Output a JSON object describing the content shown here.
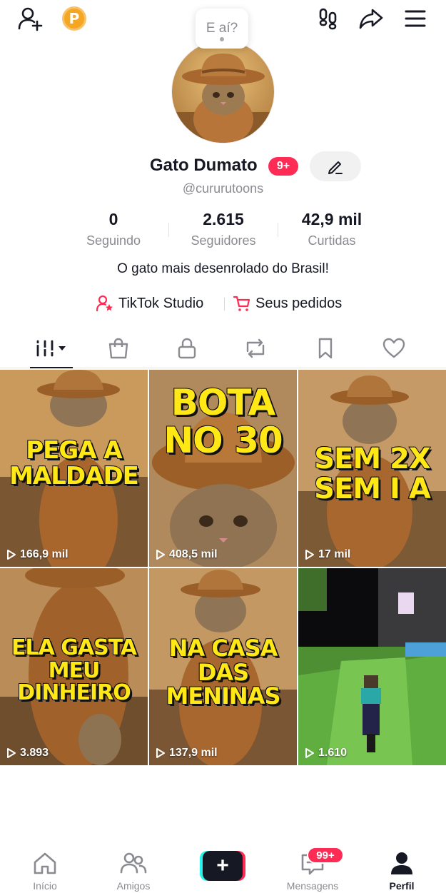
{
  "header": {
    "add_friend_icon": "person-plus-icon",
    "coin_label": "P",
    "footprint_icon": "footprint-icon",
    "share_icon": "share-arrow-icon",
    "menu_icon": "hamburger-icon"
  },
  "tooltip": {
    "text": "E aí?"
  },
  "profile": {
    "name": "Gato Dumato",
    "badge": "9+",
    "handle": "@cururutoons",
    "bio": "O gato mais desenrolado do Brasil!"
  },
  "stats": [
    {
      "value": "0",
      "label": "Seguindo"
    },
    {
      "value": "2.615",
      "label": "Seguidores"
    },
    {
      "value": "42,9 mil",
      "label": "Curtidas"
    }
  ],
  "links": {
    "studio": "TikTok Studio",
    "orders": "Seus pedidos"
  },
  "tabs": [
    "videos",
    "shop",
    "private",
    "reposts",
    "favorites",
    "liked"
  ],
  "videos": [
    {
      "caption": [
        "PEGA A",
        "MALDADE"
      ],
      "views": "166,9 mil"
    },
    {
      "caption": [
        "BOTA",
        "NO 30"
      ],
      "views": "408,5 mil"
    },
    {
      "caption": [
        "SEM 2X",
        "SEM I A"
      ],
      "views": "17 mil"
    },
    {
      "caption": [
        "ELA GASTA",
        "MEU DINHEIRO"
      ],
      "views": "3.893"
    },
    {
      "caption": [
        "NA CASA",
        "DAS MENINAS"
      ],
      "views": "137,9 mil"
    },
    {
      "caption": [],
      "views": "1.610"
    }
  ],
  "nav": {
    "home": "Início",
    "friends": "Amigos",
    "create": "+",
    "messages": "Mensagens",
    "messages_badge": "99+",
    "profile": "Perfil"
  },
  "colors": {
    "accent": "#fe2c55",
    "caption": "#ffe816",
    "secondary_text": "#8a8b91"
  }
}
